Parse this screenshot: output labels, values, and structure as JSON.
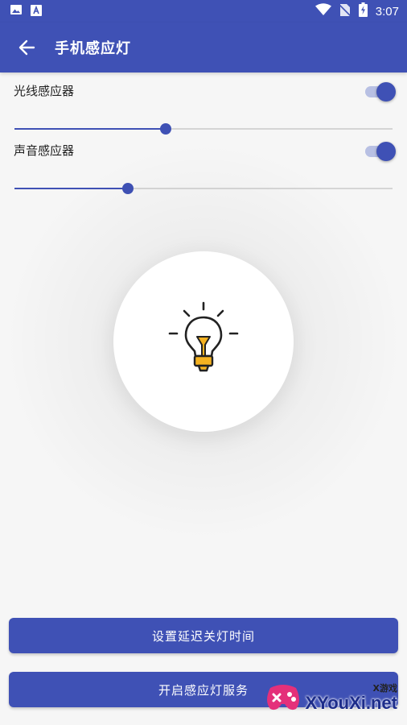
{
  "status_bar": {
    "time": "3:07"
  },
  "app_bar": {
    "title": "手机感应灯"
  },
  "settings": [
    {
      "label": "光线感应器",
      "enabled": true,
      "slider_fraction": 0.4
    },
    {
      "label": "声音感应器",
      "enabled": true,
      "slider_fraction": 0.3
    }
  ],
  "buttons": {
    "delay": "设置延迟关灯时间",
    "service": "开启感应灯服务"
  },
  "watermark": {
    "brand_small": "X游戏",
    "brand": "XYouXi.net"
  },
  "colors": {
    "primary": "#3f51b5",
    "bulb": "#f5b220",
    "track": "#b8c0e3",
    "background": "#f6f6f6"
  },
  "icons": [
    "image-icon",
    "font-icon",
    "wifi-icon",
    "no-sim-icon",
    "battery-charging-icon",
    "back-arrow-icon",
    "light-bulb-icon"
  ]
}
